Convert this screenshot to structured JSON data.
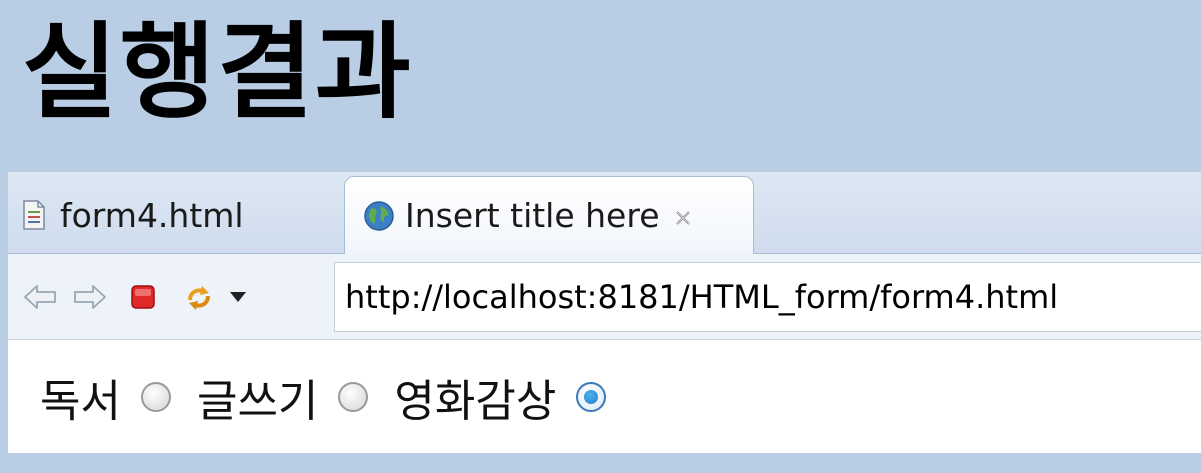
{
  "slide": {
    "title": "실행결과"
  },
  "tabs": [
    {
      "label": "form4.html",
      "icon": "html-file-icon",
      "active": false
    },
    {
      "label": "Insert title here",
      "icon": "globe-icon",
      "active": true,
      "closable": true
    }
  ],
  "toolbar": {
    "buttons": [
      "back-icon",
      "forward-icon",
      "stop-icon",
      "refresh-icon",
      "dropdown-icon"
    ],
    "url": "http://localhost:8181/HTML_form/form4.html"
  },
  "form": {
    "options": [
      {
        "label": "독서",
        "checked": false
      },
      {
        "label": "글쓰기",
        "checked": false
      },
      {
        "label": "영화감상",
        "checked": true
      }
    ]
  },
  "colors": {
    "background": "#b9cde4",
    "stop": "#e02a2a",
    "radio_selected": "#1c7fc9"
  }
}
